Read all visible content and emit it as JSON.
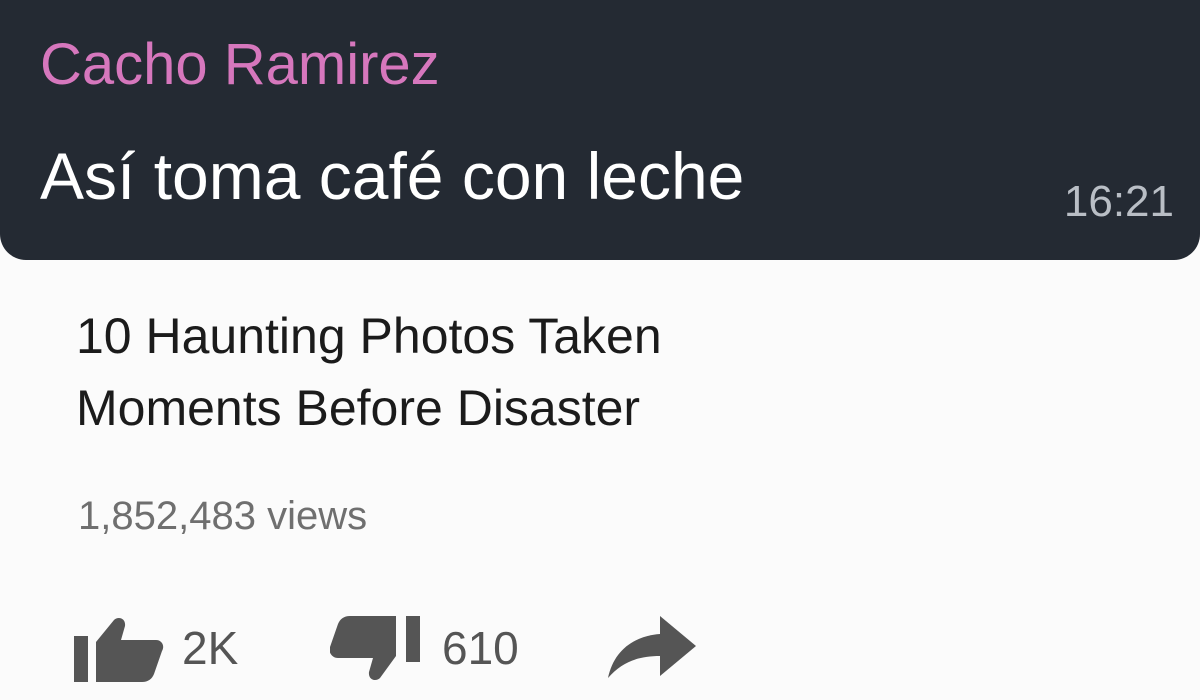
{
  "chat": {
    "sender_name": "Cacho Ramirez",
    "message": "Así toma café con leche",
    "time": "16:21",
    "colors": {
      "bubble_bg": "#242a33",
      "sender_name": "#d677bd",
      "message_text": "#ffffff",
      "time_text": "#b9bec5"
    }
  },
  "video": {
    "title_lines": [
      "10 Haunting Photos Taken",
      "Moments Before Disaster"
    ],
    "views": "1,852,483 views",
    "actions": {
      "like": {
        "icon": "thumbs-up-icon",
        "count": "2K"
      },
      "dislike": {
        "icon": "thumbs-down-icon",
        "count": "610"
      },
      "share": {
        "icon": "share-arrow-icon"
      }
    },
    "colors": {
      "title_text": "#1b1b1b",
      "views_text": "#6f6f6f",
      "icon": "#555555"
    }
  }
}
